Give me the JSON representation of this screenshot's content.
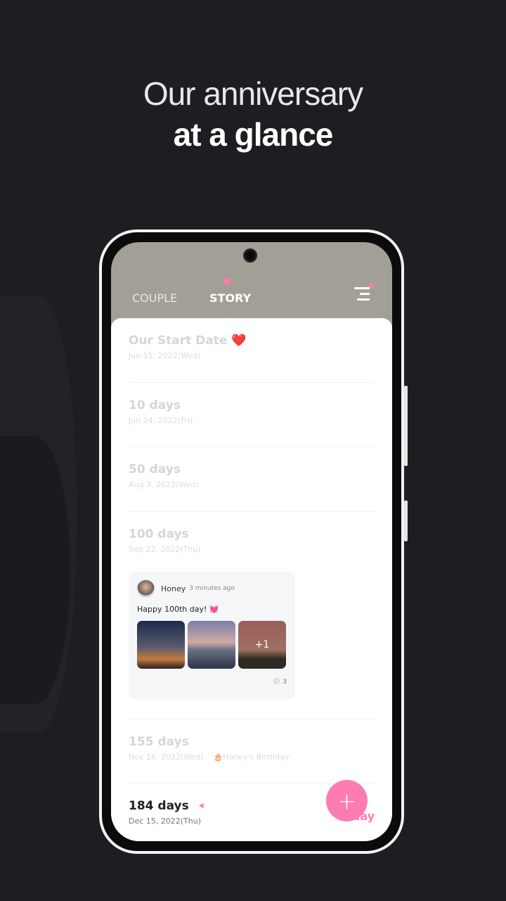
{
  "headline": {
    "line1": "Our anniversary",
    "line2": "at a glance"
  },
  "tabs": [
    {
      "label": "COUPLE"
    },
    {
      "label": "STORY",
      "active": true
    }
  ],
  "accent": "#ff7cb1",
  "timeline": [
    {
      "title": "Our Start Date ❤️",
      "date": "Jun 15, 2022(Wed)"
    },
    {
      "title": "10 days",
      "date": "Jun 24, 2022(Fri)"
    },
    {
      "title": "50 days",
      "date": "Aug 3, 2022(Wed)"
    },
    {
      "title": "100 days",
      "date": "Sep 22, 2022(Thu)"
    },
    {
      "title": "155 days",
      "date": "Nov 16, 2022(Wed)",
      "extra": "🎂Honey's Birthday"
    },
    {
      "title": "184 days",
      "date": "Dec 15, 2022(Thu)"
    }
  ],
  "post": {
    "author": "Honey",
    "time": "3 minutes ago",
    "message": "Happy 100th day! 💓",
    "more_photos": "+1",
    "comments": "3"
  },
  "today_label": "Today",
  "fab": "+"
}
